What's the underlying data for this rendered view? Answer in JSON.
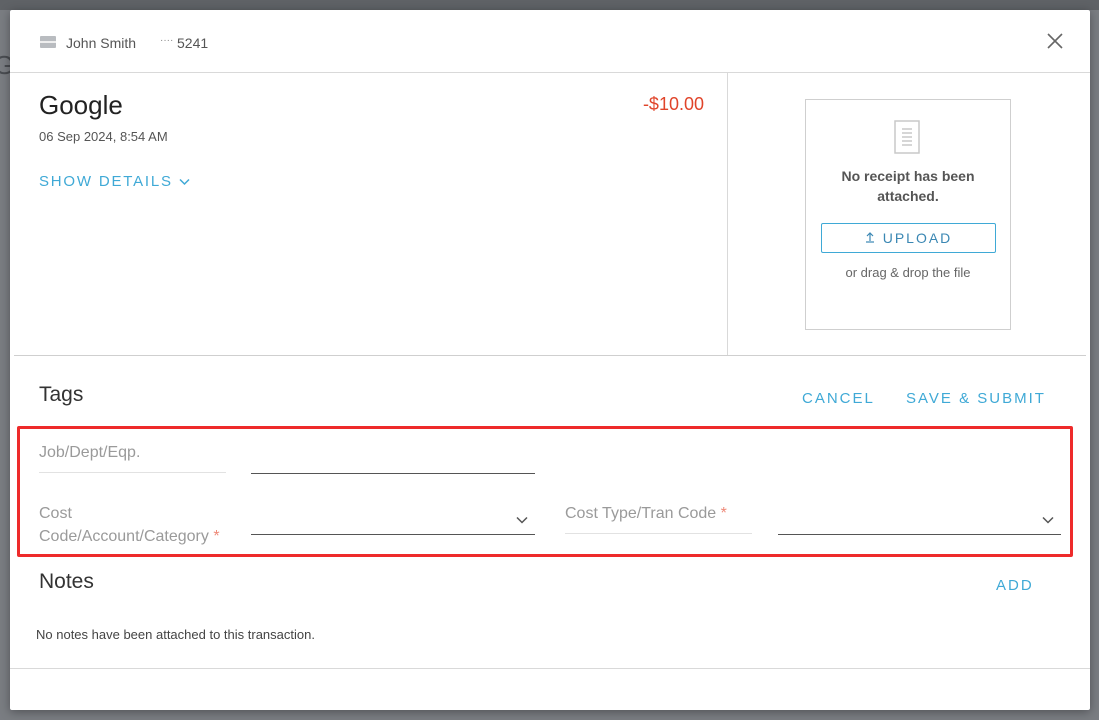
{
  "card": {
    "holder_name": "John Smith",
    "mask": "····",
    "last4": "5241"
  },
  "transaction": {
    "merchant": "Google",
    "amount": "-$10.00",
    "datetime": "06 Sep 2024, 8:54 AM",
    "show_details_label": "SHOW DETAILS"
  },
  "receipt": {
    "message": "No receipt has been attached.",
    "upload_label": "UPLOAD",
    "drag_hint": "or drag & drop the file"
  },
  "tags": {
    "title": "Tags",
    "cancel_label": "CANCEL",
    "save_submit_label": "SAVE & SUBMIT",
    "fields": {
      "job_dept_eqp": {
        "label": "Job/Dept/Eqp.",
        "value": ""
      },
      "cost_code": {
        "label_line1": "Cost",
        "label_line2": "Code/Account/Category",
        "required_mark": "*",
        "value": ""
      },
      "cost_type": {
        "label": "Cost Type/Tran Code",
        "required_mark": "*",
        "value": ""
      }
    }
  },
  "notes": {
    "title": "Notes",
    "add_label": "ADD",
    "empty_message": "No notes have been attached to this transaction."
  },
  "colors": {
    "accent": "#3fa9d6",
    "amount_negative": "#e0442a",
    "highlight": "#ee2a2a",
    "required": "#ee8877"
  },
  "icons": {
    "card": "credit-card-icon",
    "close": "close-icon",
    "chevron": "chevron-down-icon",
    "receipt": "document-icon",
    "upload": "upload-arrow-icon"
  }
}
